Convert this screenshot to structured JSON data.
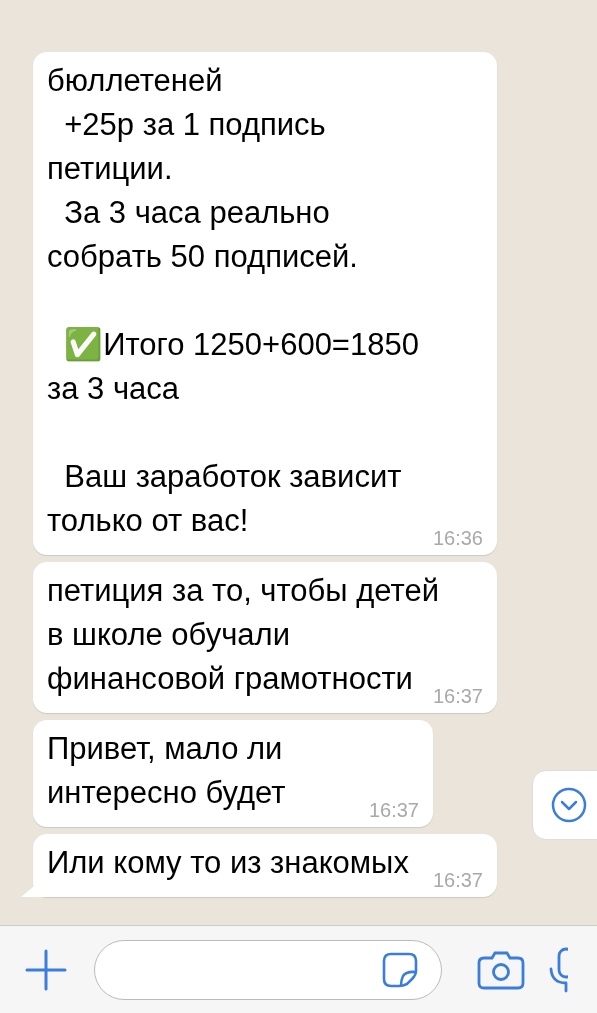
{
  "messages": [
    {
      "text": "бюллетеней\n  +25р за 1 подпись\nпетиции.\n  За 3 часа реально\nсобрать 50 подписей.\n\n  ✅Итого 1250+600=1850\nза 3 часа\n\n  Ваш заработок зависит\nтолько от вас!",
      "time": "16:36",
      "tail": false
    },
    {
      "text": "петиция за то, чтобы детей\nв школе обучали\nфинансовой грамотности",
      "time": "16:37",
      "tail": false
    },
    {
      "text": "Привет, мало ли\nинтересно будет",
      "time": "16:37",
      "tail": false
    },
    {
      "text": "Или кому то из знакомых",
      "time": "16:37",
      "tail": true
    }
  ]
}
